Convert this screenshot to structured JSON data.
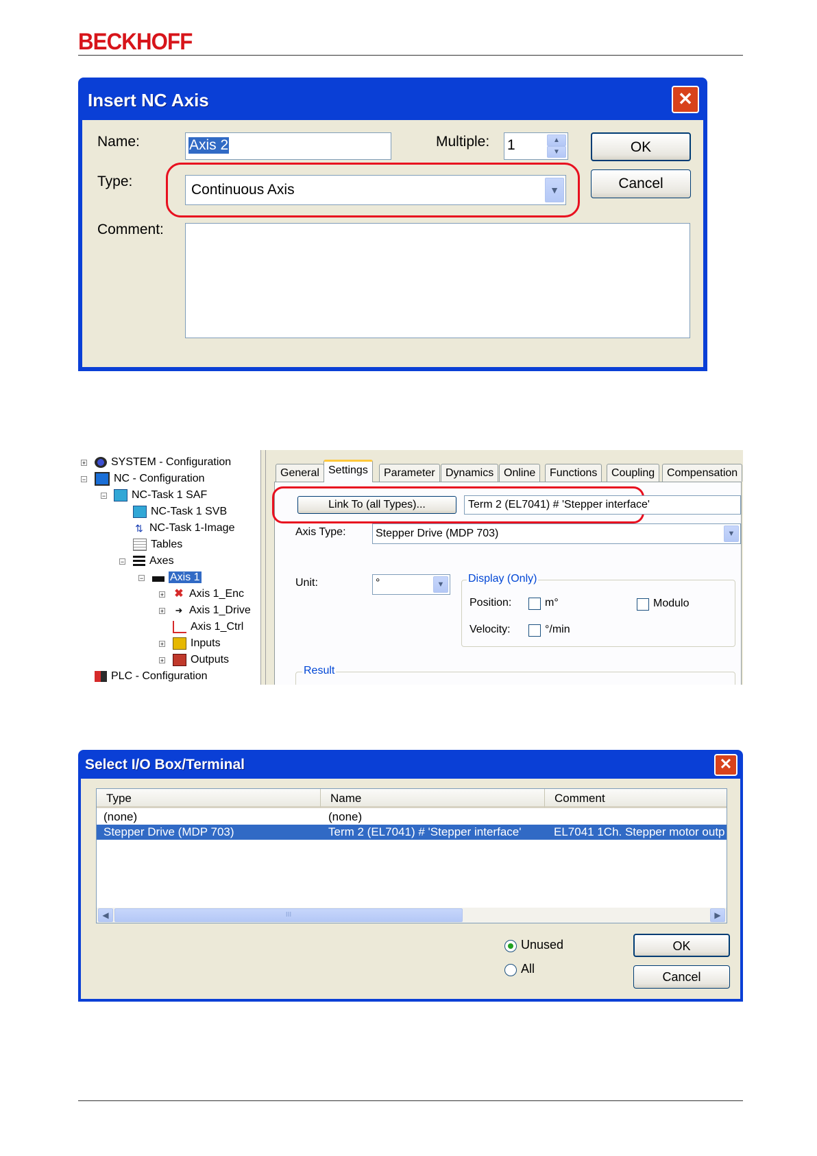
{
  "header": {
    "brand": "BECKHOFF"
  },
  "insert_nc_axis": {
    "title": "Insert NC Axis",
    "close_glyph": "✕",
    "name_label": "Name:",
    "name_value": "Axis 2",
    "multiple_label": "Multiple:",
    "multiple_value": "1",
    "type_label": "Type:",
    "type_value": "Continuous Axis",
    "comment_label": "Comment:",
    "comment_value": "",
    "ok_label": "OK",
    "cancel_label": "Cancel",
    "highlight_color": "#e8101f"
  },
  "tree": {
    "items": [
      {
        "label": "SYSTEM - Configuration",
        "expander": "+"
      },
      {
        "label": "NC - Configuration",
        "expander": "−"
      },
      {
        "label": "NC-Task 1 SAF",
        "expander": "−"
      },
      {
        "label": "NC-Task 1 SVB"
      },
      {
        "label": "NC-Task 1-Image"
      },
      {
        "label": "Tables"
      },
      {
        "label": "Axes",
        "expander": "−"
      },
      {
        "label": "Axis 1",
        "expander": "−",
        "selected": true
      },
      {
        "label": "Axis 1_Enc",
        "expander": "+"
      },
      {
        "label": "Axis 1_Drive",
        "expander": "+"
      },
      {
        "label": "Axis 1_Ctrl"
      },
      {
        "label": "Inputs",
        "expander": "+"
      },
      {
        "label": "Outputs",
        "expander": "+"
      },
      {
        "label": "PLC - Configuration"
      }
    ]
  },
  "axis_settings": {
    "tabs": [
      "General",
      "Settings",
      "Parameter",
      "Dynamics",
      "Online",
      "Functions",
      "Coupling",
      "Compensation"
    ],
    "active_tab": "Settings",
    "link_button": "Link To (all Types)...",
    "link_value": "Term 2 (EL7041) # 'Stepper interface'",
    "axis_type_label": "Axis Type:",
    "axis_type_value": "Stepper Drive (MDP 703)",
    "unit_label": "Unit:",
    "unit_value": "°",
    "display_group": "Display (Only)",
    "position_label": "Position:",
    "position_unit": "m°",
    "modulo_label": "Modulo",
    "velocity_label": "Velocity:",
    "velocity_unit": "°/min",
    "result_group": "Result"
  },
  "select_io": {
    "title": "Select I/O Box/Terminal",
    "close_glyph": "✕",
    "columns": [
      "Type",
      "Name",
      "Comment"
    ],
    "rows": [
      {
        "type": "(none)",
        "name": "(none)",
        "comment": ""
      },
      {
        "type": "Stepper Drive (MDP 703)",
        "name": "Term 2 (EL7041) # 'Stepper interface'",
        "comment": "EL7041 1Ch. Stepper motor outp",
        "selected": true
      }
    ],
    "scroll_grip": "III",
    "radio_unused": "Unused",
    "radio_all": "All",
    "selected_radio": "Unused",
    "ok_label": "OK",
    "cancel_label": "Cancel"
  }
}
